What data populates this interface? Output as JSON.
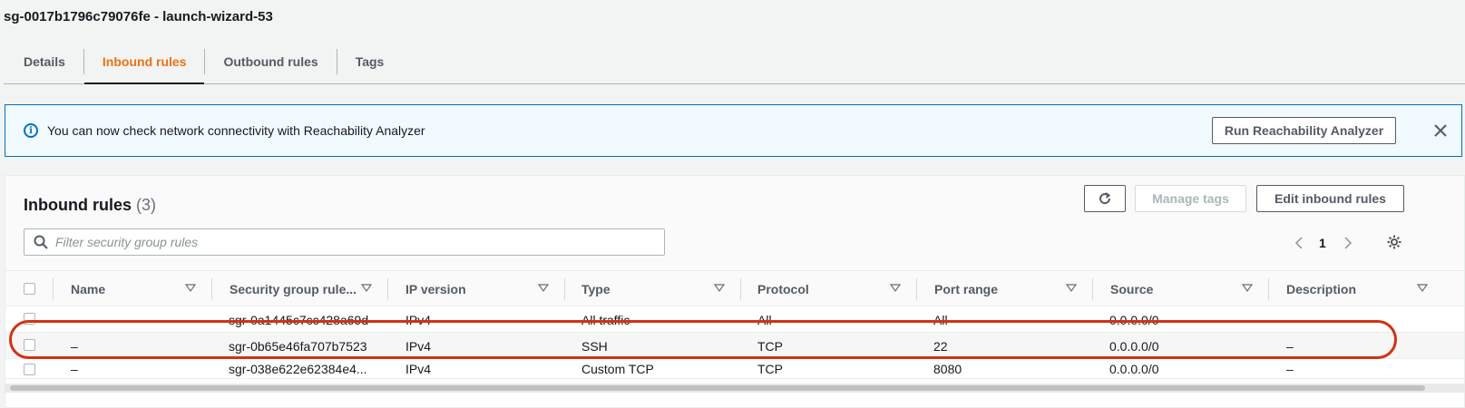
{
  "page_title": "sg-0017b1796c79076fe - launch-wizard-53",
  "tabs": [
    {
      "label": "Details",
      "active": false
    },
    {
      "label": "Inbound rules",
      "active": true
    },
    {
      "label": "Outbound rules",
      "active": false
    },
    {
      "label": "Tags",
      "active": false
    }
  ],
  "banner": {
    "icon": "info-icon",
    "text": "You can now check network connectivity with Reachability Analyzer",
    "button": "Run Reachability Analyzer",
    "close_icon": "close-icon"
  },
  "panel": {
    "title": "Inbound rules",
    "count": "(3)",
    "refresh_icon": "refresh-icon",
    "manage_tags": "Manage tags",
    "edit_rules": "Edit inbound rules",
    "search_placeholder": "Filter security group rules",
    "page": "1"
  },
  "table": {
    "columns": [
      "Name",
      "Security group rule...",
      "IP version",
      "Type",
      "Protocol",
      "Port range",
      "Source",
      "Description"
    ],
    "rows": [
      {
        "name": "–",
        "rule_id": "sgr-0a1445c7cc428a69d",
        "ip_version": "IPv4",
        "type": "All traffic",
        "protocol": "All",
        "port_range": "All",
        "source": "0.0.0.0/0",
        "description": "–"
      },
      {
        "name": "–",
        "rule_id": "sgr-0b65e46fa707b7523",
        "ip_version": "IPv4",
        "type": "SSH",
        "protocol": "TCP",
        "port_range": "22",
        "source": "0.0.0.0/0",
        "description": "–"
      },
      {
        "name": "–",
        "rule_id": "sgr-038e622e62384e4...",
        "ip_version": "IPv4",
        "type": "Custom TCP",
        "protocol": "TCP",
        "port_range": "8080",
        "source": "0.0.0.0/0",
        "description": "–"
      }
    ]
  },
  "colors": {
    "accent": "#ec7211",
    "info": "#0073bb",
    "highlight": "#d13212"
  }
}
